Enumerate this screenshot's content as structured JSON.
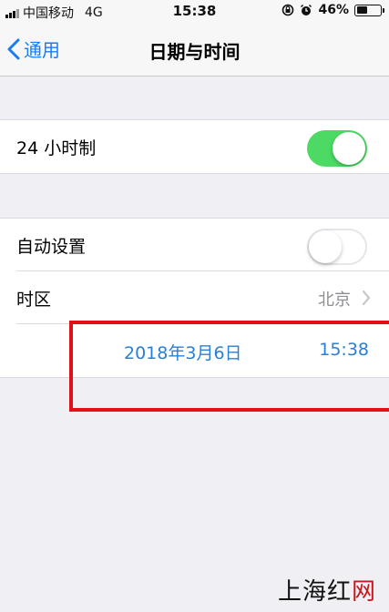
{
  "status_bar": {
    "carrier": "中国移动",
    "network": "4G",
    "time": "15:38",
    "battery_percent": "46%",
    "battery_level": 0.46
  },
  "nav": {
    "back_label": "通用",
    "title": "日期与时间"
  },
  "settings": {
    "hour24": {
      "label": "24 小时制",
      "enabled": true
    },
    "auto_set": {
      "label": "自动设置",
      "enabled": false
    },
    "timezone": {
      "label": "时区",
      "value": "北京"
    },
    "date_value": "2018年3月6日",
    "time_value": "15:38"
  },
  "colors": {
    "accent": "#1a7cf4",
    "toggle_on": "#4cd964",
    "highlight": "#e0101a",
    "date_time_text": "#2a7fd4"
  },
  "watermark": {
    "prefix": "上海红",
    "suffix": "网"
  }
}
